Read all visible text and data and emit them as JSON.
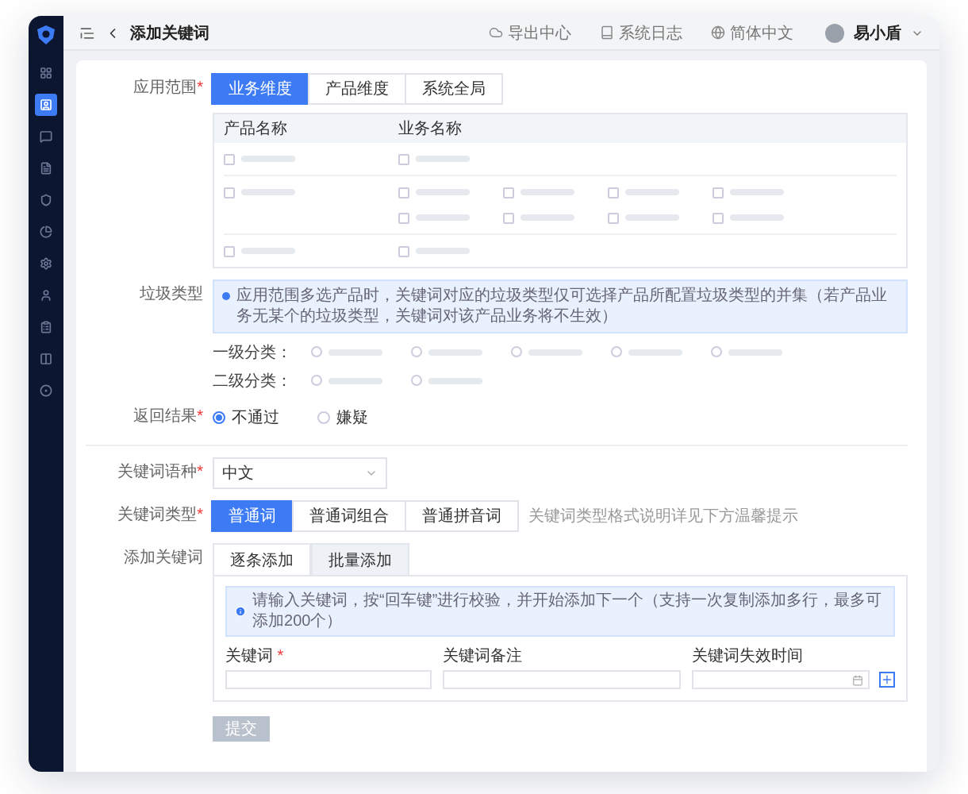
{
  "header": {
    "title": "添加关键词",
    "links": [
      {
        "label": "导出中心",
        "kind": "cloud"
      },
      {
        "label": "系统日志",
        "kind": "log"
      },
      {
        "label": "简体中文",
        "kind": "globe"
      }
    ],
    "user": "易小盾"
  },
  "sidebar": {
    "items": [
      {
        "selected": false
      },
      {
        "selected": true
      },
      {
        "selected": false
      },
      {
        "selected": false
      },
      {
        "selected": false
      },
      {
        "selected": false
      },
      {
        "selected": false
      },
      {
        "selected": false
      },
      {
        "selected": false
      },
      {
        "selected": false
      },
      {
        "selected": false
      }
    ]
  },
  "form": {
    "scope": {
      "label": "应用范围",
      "mark": "*",
      "tabs": [
        {
          "label": "业务维度",
          "selected": true
        },
        {
          "label": "产品维度",
          "selected": false
        },
        {
          "label": "系统全局",
          "selected": false
        }
      ],
      "table": {
        "columns": [
          "产品名称",
          "业务名称"
        ],
        "rows": [
          {
            "product": {
              "checked": false
            },
            "businesses": [
              {
                "checked": false
              }
            ]
          },
          {
            "product": {
              "checked": false
            },
            "businesses": [
              {
                "checked": false
              },
              {
                "checked": false
              },
              {
                "checked": false
              },
              {
                "checked": false
              },
              {
                "checked": false
              },
              {
                "checked": false
              },
              {
                "checked": false
              },
              {
                "checked": false
              }
            ]
          },
          {
            "product": {
              "checked": false
            },
            "businesses": [
              {
                "checked": false
              }
            ]
          }
        ]
      }
    },
    "garbage": {
      "label": "垃圾类型",
      "hint": "应用范围多选产品时，关键词对应的垃圾类型仅可选择产品所配置垃圾类型的并集（若产品业务无某个的垃圾类型，关键词对该产品业务将不生效）",
      "groups": [
        {
          "label": "一级分类：",
          "options": [
            {
              "selected": false
            },
            {
              "selected": false
            },
            {
              "selected": false
            },
            {
              "selected": false
            },
            {
              "selected": false
            }
          ]
        },
        {
          "label": "二级分类：",
          "options": [
            {
              "selected": false
            },
            {
              "selected": false
            }
          ]
        }
      ]
    },
    "result": {
      "label": "返回结果",
      "mark": "*",
      "options": [
        {
          "label": "不通过",
          "selected": true
        },
        {
          "label": "嫌疑",
          "selected": false
        }
      ]
    },
    "language": {
      "label": "关键词语种",
      "mark": "*",
      "value": "中文"
    },
    "type": {
      "label": "关键词类型",
      "mark": "*",
      "options": [
        {
          "label": "普通词",
          "selected": true
        },
        {
          "label": "普通词组合",
          "selected": false
        },
        {
          "label": "普通拼音词",
          "selected": false
        }
      ],
      "note": "关键词类型格式说明详见下方温馨提示"
    },
    "add": {
      "label": "添加关键词",
      "tabs": [
        {
          "label": "逐条添加",
          "selected": true
        },
        {
          "label": "批量添加",
          "selected": false
        }
      ],
      "info": "请输入关键词，按“回车键”进行校验，并开始添加下一个（支持一次复制添加多行，最多可添加200个）",
      "fields": [
        {
          "label": "关键词",
          "mark": "*",
          "kind": "text"
        },
        {
          "label": "关键词备注",
          "kind": "text"
        },
        {
          "label": "关键词失效时间",
          "kind": "date"
        }
      ]
    },
    "submit": {
      "label": "提交",
      "disabled": true
    }
  }
}
